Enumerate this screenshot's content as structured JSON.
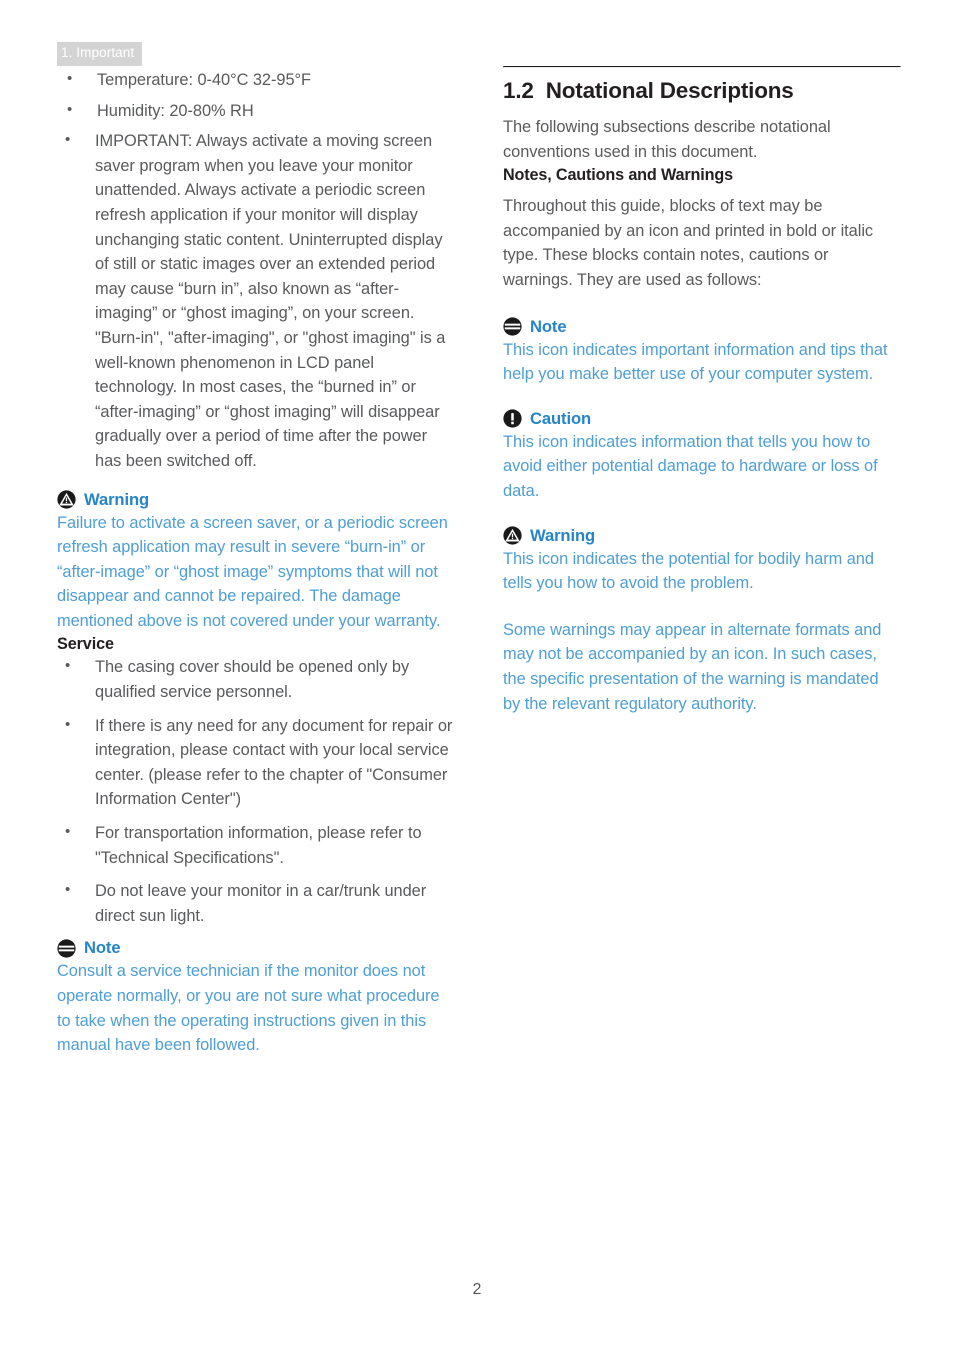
{
  "header": {
    "running_head": "1. Important"
  },
  "left_column": {
    "spec_bullets": [
      "Temperature: 0-40°C 32-95°F",
      "Humidity: 20-80% RH"
    ],
    "important_bullet": "IMPORTANT: Always activate a moving screen saver program when you leave your monitor unattended. Always activate a periodic screen refresh application if your monitor will display unchanging static content. Uninterrupted display of still or static images over an extended period may cause “burn in”, also known as “after-imaging” or “ghost imaging”, on your screen.",
    "important_bullet_part2": "\"Burn-in\", \"after-imaging\", or \"ghost imaging\" is a well-known phenomenon in LCD panel technology. In most cases, the “burned in” or “after-imaging” or “ghost imaging” will disappear gradually over a period of time after the power has been switched off.",
    "warning": {
      "icon": "warning-triangle-icon",
      "label": "Warning",
      "body": "Failure to activate a screen saver, or a periodic screen refresh application may result in severe “burn-in” or “after-image” or “ghost image” symptoms that will not disappear and cannot be repaired. The damage mentioned above is not covered under your warranty."
    },
    "service": {
      "title": "Service",
      "bullets": [
        "The casing cover should be opened only by qualified service personnel.",
        "If there is any need for any document for repair or integration, please contact with your local service center. (please refer to the chapter of \"Consumer Information Center\")",
        "For transportation information, please refer to \"Technical Specifications\".",
        "Do not leave your monitor in a car/trunk under direct sun light."
      ]
    },
    "note": {
      "icon": "note-icon",
      "label": "Note",
      "body": "Consult a service technician if the monitor does not operate normally, or you are not sure what procedure to take when the operating instructions given in this manual have been followed."
    }
  },
  "right_column": {
    "section_number": "1.2",
    "section_title": "Notational Descriptions",
    "intro": "The following subsections describe notational conventions used in this document.",
    "subsection_title": "Notes, Cautions and Warnings",
    "subsection_intro": "Throughout this guide, blocks of text may be accompanied by an icon and printed in bold or italic type. These blocks contain notes, cautions or warnings. They are used as follows:",
    "note": {
      "icon": "note-icon",
      "label": "Note",
      "body": "This icon indicates important information and tips that help you make better use of your computer system."
    },
    "caution": {
      "icon": "caution-exclamation-icon",
      "label": "Caution",
      "body": "This icon indicates information that tells you how to avoid either potential damage to hardware or loss of data."
    },
    "warning": {
      "icon": "warning-triangle-icon",
      "label": "Warning",
      "body": "This icon indicates the potential for bodily harm and tells you how to avoid the problem.",
      "body2": "Some warnings may appear in alternate formats and may not be accompanied by an icon. In such cases, the specific presentation of the warning is mandated by the relevant regulatory authority."
    }
  },
  "footer": {
    "page_number": "2"
  },
  "colors": {
    "accent_blue": "#2585c8",
    "body_blue": "#4e9ed4",
    "body_gray": "#595a5c",
    "heading_black": "#231f20",
    "header_band": "#d4d4d4"
  }
}
